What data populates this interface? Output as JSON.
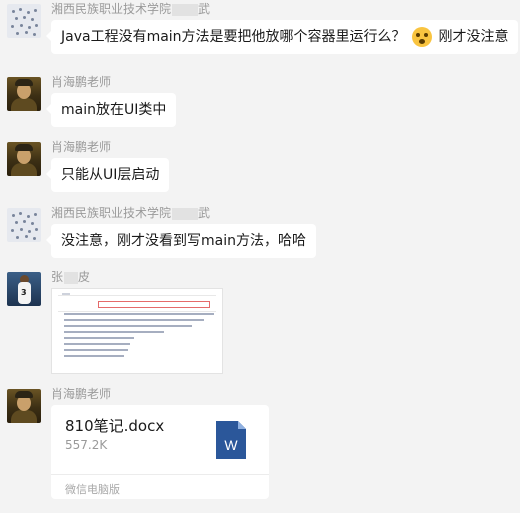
{
  "messages": [
    {
      "sender": "湘西民族职业技术学院",
      "sender_tail": "武",
      "text": "Java工程没有main方法是要把他放哪个容器里运行么？",
      "text_after": "刚才没注意",
      "emoji": "flushed-face"
    },
    {
      "sender": "肖海鹏老师",
      "text": "main放在UI类中"
    },
    {
      "sender": "肖海鹏老师",
      "text": "只能从UI层启动"
    },
    {
      "sender": "湘西民族职业技术学院",
      "sender_tail": "武",
      "text": "没注意，刚才没看到写main方法，哈哈"
    },
    {
      "sender": "张",
      "sender_tail": "皮",
      "image": "code-screenshot"
    },
    {
      "sender": "肖海鹏老师",
      "file": {
        "name": "810笔记.docx",
        "size": "557.2K",
        "source": "微信电脑版",
        "icon": "word-doc-icon",
        "icon_label": "W"
      }
    }
  ],
  "colors": {
    "background": "#f3f3f3",
    "bubble": "#ffffff",
    "word": "#2b579a",
    "sender": "#9a9a9a"
  }
}
